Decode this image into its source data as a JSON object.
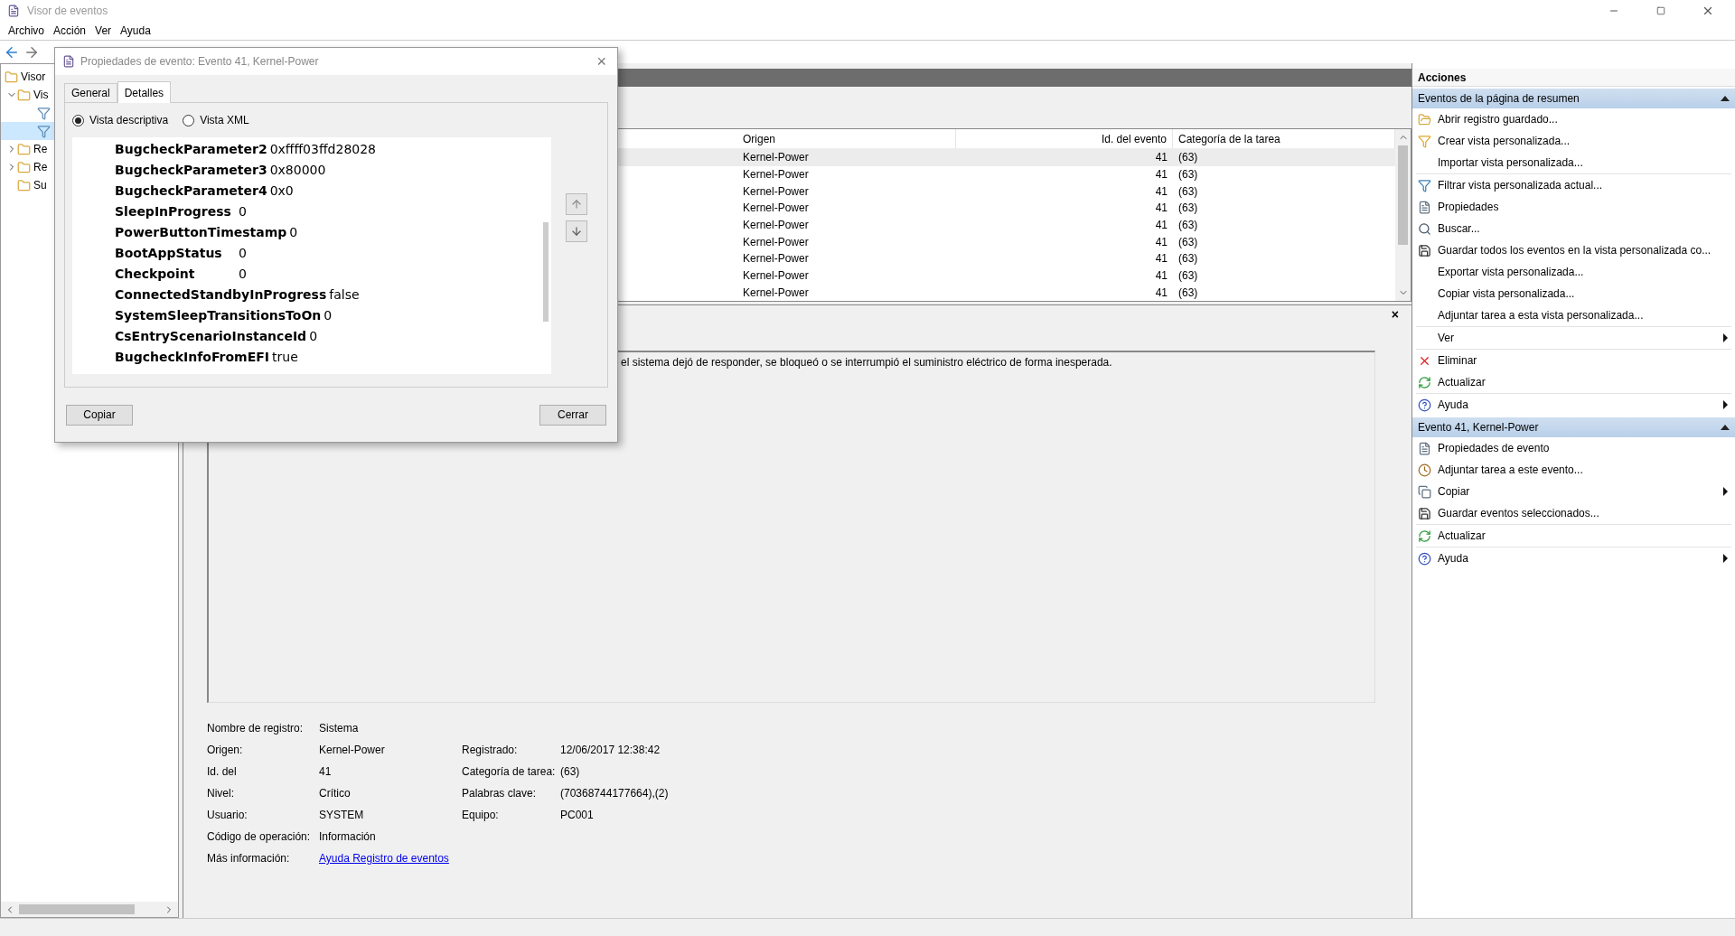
{
  "window": {
    "title": "Visor de eventos"
  },
  "menu": [
    "Archivo",
    "Acción",
    "Ver",
    "Ayuda"
  ],
  "tree": [
    {
      "label": "Visor",
      "children": [
        {
          "label": "Vis",
          "expanded": true,
          "children": [
            {
              "selected": false
            },
            {
              "selected": true
            }
          ]
        },
        {
          "label": "Re",
          "expanded": false
        },
        {
          "label": "Re",
          "expanded": false
        },
        {
          "label": "Su"
        }
      ]
    }
  ],
  "table": {
    "columns": [
      "Origen",
      "Id. del evento",
      "Categoría de la tarea"
    ],
    "rows": [
      {
        "origin": "Kernel-Power",
        "id": "41",
        "category": "(63)",
        "selected": true
      },
      {
        "origin": "Kernel-Power",
        "id": "41",
        "category": "(63)",
        "selected": false
      },
      {
        "origin": "Kernel-Power",
        "id": "41",
        "category": "(63)",
        "selected": false
      },
      {
        "origin": "Kernel-Power",
        "id": "41",
        "category": "(63)",
        "selected": false
      },
      {
        "origin": "Kernel-Power",
        "id": "41",
        "category": "(63)",
        "selected": false
      },
      {
        "origin": "Kernel-Power",
        "id": "41",
        "category": "(63)",
        "selected": false
      },
      {
        "origin": "Kernel-Power",
        "id": "41",
        "category": "(63)",
        "selected": false
      },
      {
        "origin": "Kernel-Power",
        "id": "41",
        "category": "(63)",
        "selected": false
      },
      {
        "origin": "Kernel-Power",
        "id": "41",
        "category": "(63)",
        "selected": false
      }
    ]
  },
  "preview": {
    "close": "×",
    "description": "el sistema dejó de responder, se bloqueó o se interrumpió el suministro eléctrico de forma inesperada.",
    "fields": [
      [
        {
          "label": "Nombre de registro:",
          "value": "Sistema"
        }
      ],
      [
        {
          "label": "Origen:",
          "value": "Kernel-Power"
        },
        {
          "label": "Registrado:",
          "value": "12/06/2017 12:38:42"
        }
      ],
      [
        {
          "label": "Id. del",
          "value": "41"
        },
        {
          "label": "Categoría de tarea:",
          "value": "(63)"
        }
      ],
      [
        {
          "label": "Nivel:",
          "value": "Crítico"
        },
        {
          "label": "Palabras clave:",
          "value": "(70368744177664),(2)"
        }
      ],
      [
        {
          "label": "Usuario:",
          "value": "SYSTEM"
        },
        {
          "label": "Equipo:",
          "value": "PC001"
        }
      ],
      [
        {
          "label": "Código de operación:",
          "value": "Información"
        }
      ],
      [
        {
          "label": "Más información:",
          "value": "Ayuda Registro de eventos",
          "kind": "link"
        }
      ]
    ]
  },
  "actions": {
    "title": "Acciones",
    "sections": [
      {
        "title": "Eventos de la página de resumen",
        "expanded": true,
        "groups": [
          [
            {
              "label": "Abrir registro guardado...",
              "kind": "folder"
            },
            {
              "label": "Crear vista personalizada...",
              "kind": "filter-new"
            },
            {
              "label": "Importar vista personalizada..."
            }
          ],
          [
            {
              "label": "Filtrar vista personalizada actual...",
              "kind": "filter"
            },
            {
              "label": "Propiedades",
              "kind": "properties"
            },
            {
              "label": "Buscar...",
              "kind": "binoculars"
            },
            {
              "label": "Guardar todos los eventos en la vista personalizada co...",
              "kind": "save"
            },
            {
              "label": "Exportar vista personalizada..."
            },
            {
              "label": "Copiar vista personalizada..."
            },
            {
              "label": "Adjuntar tarea a esta vista personalizada..."
            }
          ],
          [
            {
              "label": "Ver",
              "submenu": true
            }
          ],
          [
            {
              "label": "Eliminar",
              "kind": "delete"
            },
            {
              "label": "Actualizar",
              "kind": "refresh"
            }
          ],
          [
            {
              "label": "Ayuda",
              "kind": "help",
              "submenu": true
            }
          ]
        ]
      },
      {
        "title": "Evento 41, Kernel-Power",
        "expanded": true,
        "groups": [
          [
            {
              "label": "Propiedades de evento",
              "kind": "properties"
            },
            {
              "label": "Adjuntar tarea a este evento...",
              "kind": "task"
            },
            {
              "label": "Copiar",
              "kind": "copy",
              "submenu": true
            },
            {
              "label": "Guardar eventos seleccionados...",
              "kind": "save"
            }
          ],
          [
            {
              "label": "Actualizar",
              "kind": "refresh"
            }
          ],
          [
            {
              "label": "Ayuda",
              "kind": "help",
              "submenu": true
            }
          ]
        ]
      }
    ]
  },
  "dialog": {
    "title": "Propiedades de evento: Evento 41, Kernel-Power",
    "close": "×",
    "tabs": [
      {
        "label": "General",
        "selected": false
      },
      {
        "label": "Detalles",
        "selected": true
      }
    ],
    "views": [
      {
        "label": "Vista descriptiva",
        "selected": true
      },
      {
        "label": "Vista XML",
        "selected": false
      }
    ],
    "details": [
      {
        "name": "BugcheckParameter2",
        "value": "0xffff03ffd28028"
      },
      {
        "name": "BugcheckParameter3",
        "value": "0x80000"
      },
      {
        "name": "BugcheckParameter4",
        "value": "0x0"
      },
      {
        "name": "SleepInProgress",
        "value": "0"
      },
      {
        "name": "PowerButtonTimestamp",
        "value": "0"
      },
      {
        "name": "BootAppStatus",
        "value": "0"
      },
      {
        "name": "Checkpoint",
        "value": "0"
      },
      {
        "name": "ConnectedStandbyInProgress",
        "value": "false"
      },
      {
        "name": "SystemSleepTransitionsToOn",
        "value": "0"
      },
      {
        "name": "CsEntryScenarioInstanceId",
        "value": "0"
      },
      {
        "name": "BugcheckInfoFromEFI",
        "value": "true"
      }
    ],
    "buttons": [
      "Copiar",
      "Cerrar"
    ]
  }
}
